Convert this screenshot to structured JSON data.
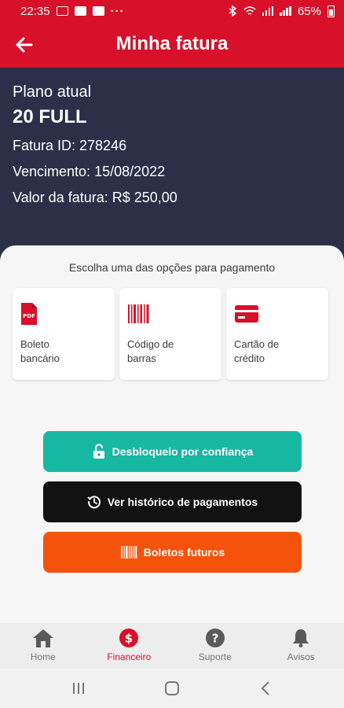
{
  "status_bar": {
    "time": "22:35",
    "dots": "···",
    "battery": "65%"
  },
  "app_bar": {
    "title": "Minha fatura"
  },
  "plan": {
    "label": "Plano atual",
    "name": "20 FULL",
    "invoice_id": "Fatura ID: 278246",
    "due_date": "Vencimento: 15/08/2022",
    "amount": "Valor da fatura: R$ 250,00"
  },
  "payment": {
    "heading": "Escolha uma das opções para pagamento",
    "options": [
      {
        "label": "Boleto bancário",
        "icon": "pdf-icon"
      },
      {
        "label": "Código de barras",
        "icon": "barcode-icon"
      },
      {
        "label": "Cartão de crédito",
        "icon": "credit-card-icon"
      }
    ]
  },
  "actions": {
    "trust_unlock": "Desbloqueio por confiança",
    "history": "Ver histórico de pagamentos",
    "future_slips": "Boletos futuros"
  },
  "bottom_nav": [
    {
      "label": "Home",
      "icon": "home-icon"
    },
    {
      "label": "Financeiro",
      "icon": "dollar-icon",
      "active": true
    },
    {
      "label": "Suporte",
      "icon": "help-icon"
    },
    {
      "label": "Avisos",
      "icon": "bell-icon"
    }
  ],
  "colors": {
    "brand_red": "#d8102a",
    "panel_navy": "#2b3048",
    "teal": "#17b8a1",
    "orange": "#f5520c"
  }
}
